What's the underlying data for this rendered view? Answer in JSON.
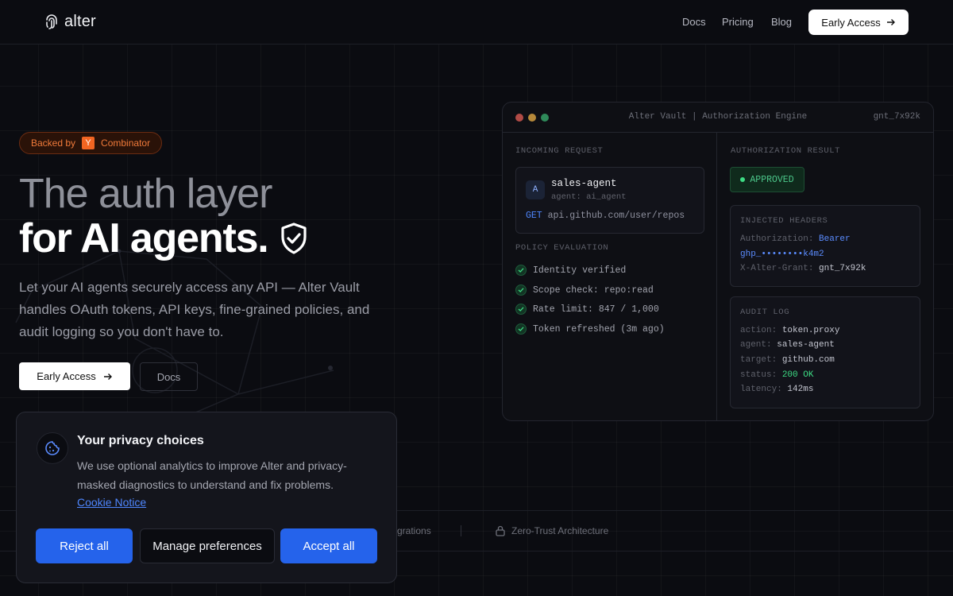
{
  "nav": {
    "logo_text": "alter",
    "links": [
      "Docs",
      "Pricing",
      "Blog"
    ],
    "cta_label": "Early Access"
  },
  "hero": {
    "badge": {
      "prefix": "Backed by",
      "letter": "Y",
      "suffix": "Combinator"
    },
    "title_line1": "The auth layer",
    "title_line2": "for AI agents.",
    "lead": "Let your AI agents securely access any API — Alter Vault handles OAuth tokens, API keys, fine-grained policies, and audit logging so you don't have to.",
    "primary_cta": "Early Access",
    "secondary_cta": "Docs"
  },
  "strip": {
    "items": [
      "grations",
      "Zero-Trust Architecture"
    ]
  },
  "vault": {
    "title": "Alter Vault | Authorization Engine",
    "grant_id": "gnt_7x92k",
    "incoming_label": "INCOMING REQUEST",
    "agent_initial": "A",
    "agent_name": "sales-agent",
    "agent_sub": "agent: ai_agent",
    "method": "GET",
    "endpoint": "api.github.com/user/repos",
    "policy_label": "POLICY EVALUATION",
    "policy_checks": [
      "Identity verified",
      "Scope check: repo:read",
      "Rate limit: 847 / 1,000",
      "Token refreshed (3m ago)"
    ],
    "result_label": "AUTHORIZATION RESULT",
    "result_status": "APPROVED",
    "headers_label": "INJECTED HEADERS",
    "headers": {
      "auth_key": "Authorization:",
      "auth_val_1": "Bearer",
      "auth_val_2": "ghp_••••••••k4m2",
      "grant_key": "X-Alter-Grant:",
      "grant_val": "gnt_7x92k"
    },
    "audit_label": "AUDIT LOG",
    "audit": [
      {
        "k": "action:",
        "v": "token.proxy"
      },
      {
        "k": "agent:",
        "v": "sales-agent"
      },
      {
        "k": "target:",
        "v": "github.com"
      },
      {
        "k": "status:",
        "v": "200 OK"
      },
      {
        "k": "latency:",
        "v": "142ms"
      }
    ]
  },
  "privacy": {
    "title": "Your privacy choices",
    "text": "We use optional analytics to improve Alter and privacy-masked diagnostics to understand and fix problems.",
    "link": "Cookie Notice",
    "reject": "Reject all",
    "manage": "Manage preferences",
    "accept": "Accept all"
  },
  "colors": {
    "accent": "#2563eb",
    "approved": "#3ddc84",
    "yc_orange": "#f26522"
  }
}
